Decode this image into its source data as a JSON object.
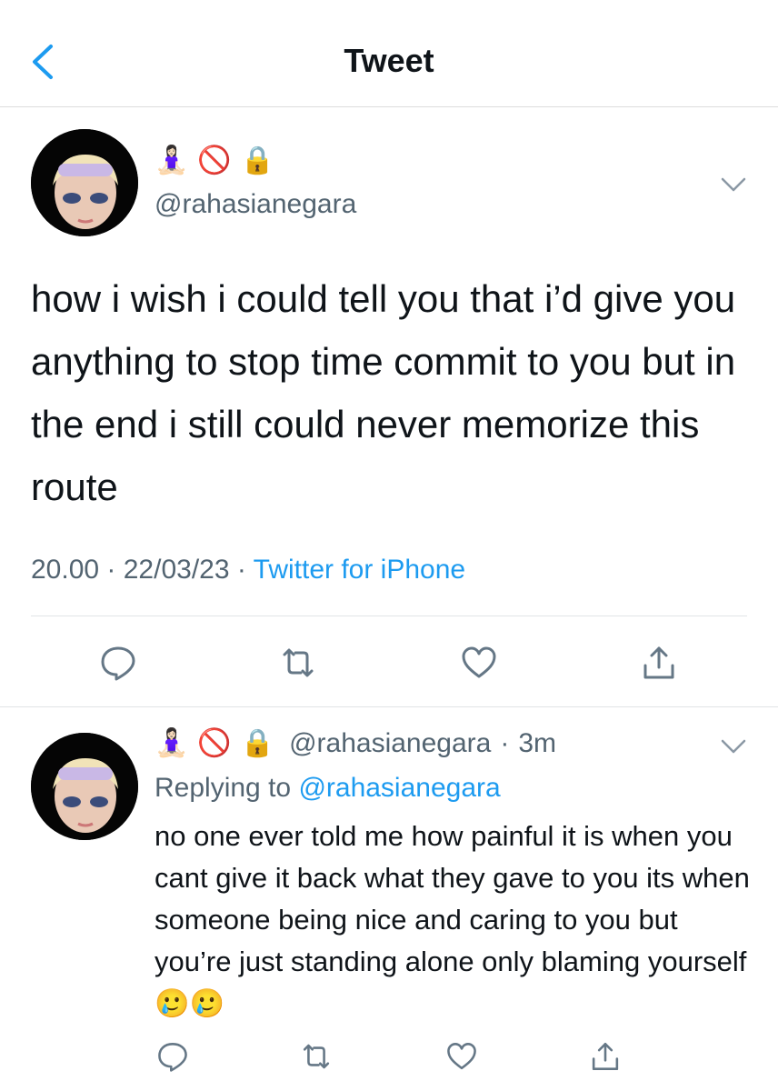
{
  "nav": {
    "title": "Tweet"
  },
  "tweet": {
    "display_name_emojis": [
      "🧘🏻‍♀️",
      "🚫",
      "🔒"
    ],
    "handle": "@rahasianegara",
    "text": "how i wish i could tell you that i’d give you anything to stop time commit to you but in the end i still could never memorize this route",
    "time": "20.00",
    "date": "22/03/23",
    "source": "Twitter for iPhone",
    "separator": " · "
  },
  "reply": {
    "display_name_emojis": [
      "🧘🏻‍♀️",
      "🚫",
      "🔒"
    ],
    "handle": "@rahasianegara",
    "age_sep": "·",
    "age": "3m",
    "replying_prefix": "Replying to ",
    "replying_to": "@rahasianegara",
    "text": "no one ever told me how painful it is when you cant give it back what they gave to you its when someone being nice and caring to you but you’re just standing alone only blaming yourself",
    "trailing_emojis": "🥲🥲"
  },
  "colors": {
    "accent": "#1d9bf0",
    "muted": "#536471",
    "text": "#0f1419",
    "divider": "#e1e4e6"
  },
  "icons": [
    "back-chevron-icon",
    "caret-down-icon",
    "reply-icon",
    "retweet-icon",
    "like-icon",
    "share-icon"
  ]
}
